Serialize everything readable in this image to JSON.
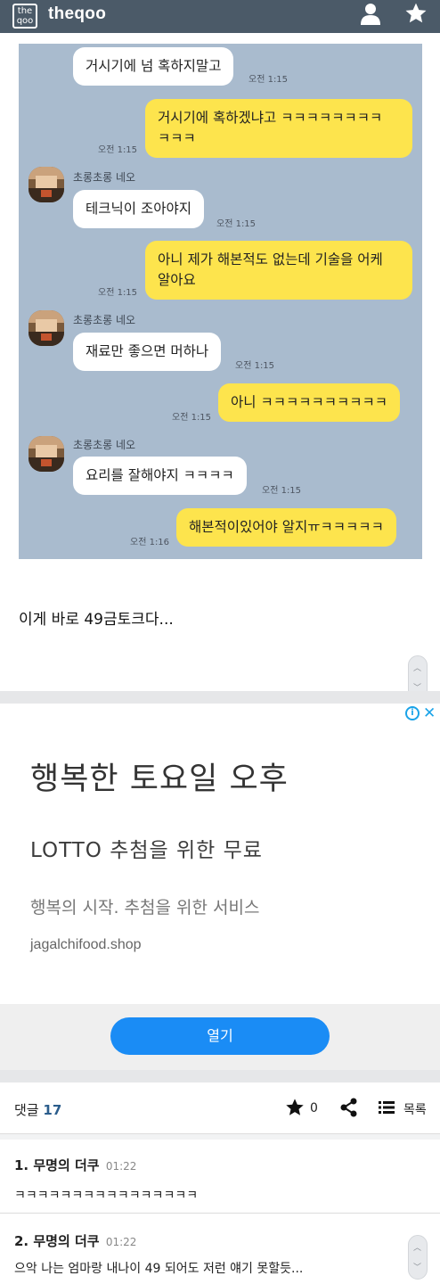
{
  "header": {
    "logo_box": "the\nqoo",
    "site_name": "theqoo",
    "icons": [
      "user-icon",
      "star-icon"
    ],
    "bar_color": "#4b5a68"
  },
  "chat": {
    "background": "#a9bbce",
    "sender_name": "초롱초롱 네오",
    "messages": [
      {
        "side": "left",
        "text": "거시기에 넘 혹하지말고",
        "time": "오전 1:15"
      },
      {
        "side": "right",
        "text": "거시기에 혹하겠냐고 ㅋㅋㅋㅋㅋㅋㅋㅋ\nㅋㅋㅋ",
        "time": "오전 1:15"
      },
      {
        "side": "left",
        "text": "테크닉이 조아야지",
        "time": "오전 1:15"
      },
      {
        "side": "right",
        "text": "아니 제가 해본적도 없는데 기술을 어케\n알아요",
        "time": "오전 1:15"
      },
      {
        "side": "left",
        "text": "재료만 좋으면 머하나",
        "time": "오전 1:15"
      },
      {
        "side": "right",
        "text": "아니 ㅋㅋㅋㅋㅋㅋㅋㅋㅋㅋ",
        "time": "오전 1:15"
      },
      {
        "side": "left",
        "text": "요리를 잘해야지 ㅋㅋㅋㅋ",
        "time": "오전 1:15"
      },
      {
        "side": "right",
        "text": "해본적이있어야 알지ㅠㅋㅋㅋㅋㅋ",
        "time": "오전 1:16"
      }
    ]
  },
  "post": {
    "text": "이게 바로 49금토크다..."
  },
  "ad": {
    "headline": "행복한 토요일 오후",
    "subheadline": "LOTTO 추첨을 위한 무료",
    "description": "행복의 시작. 추첨을 위한 서비스",
    "domain": "jagalchifood.shop",
    "button_label": "열기",
    "info_glyph": "i",
    "close_glyph": "✕",
    "accent": "#1a8cf5"
  },
  "comments_bar": {
    "label": "댓글",
    "count": "17",
    "star_count": "0",
    "list_label": "목록"
  },
  "comments": [
    {
      "author": "1. 무명의 더쿠",
      "time": "01:22",
      "text": "ㅋㅋㅋㅋㅋㅋㅋㅋㅋㅋㅋㅋㅋㅋㅋㅋ"
    },
    {
      "author": "2. 무명의 더쿠",
      "time": "01:22",
      "text": "으악 나는 엄마랑 내나이 49 되어도 저런 얘기 못할듯..."
    }
  ]
}
